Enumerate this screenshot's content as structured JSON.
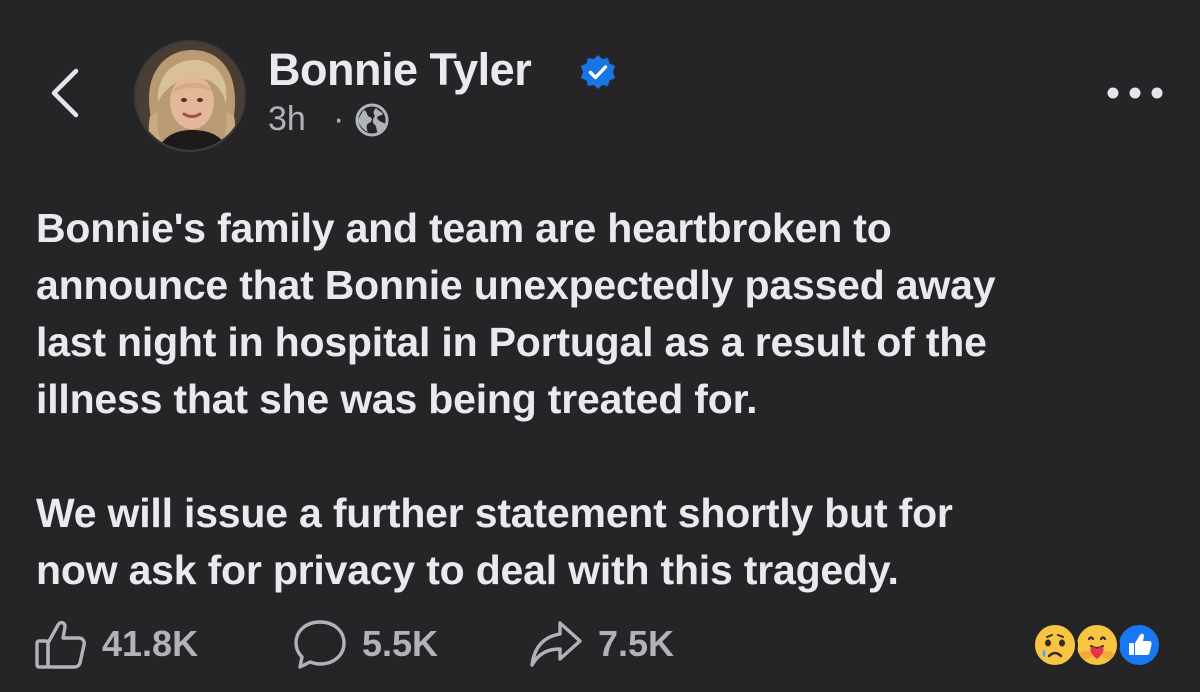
{
  "header": {
    "author_name": "Bonnie Tyler",
    "timestamp": "3h",
    "separator": "·",
    "back_icon": "chevron-left-icon",
    "verified_icon": "verified-badge-icon",
    "privacy_icon": "globe-icon",
    "more_icon": "more-horizontal-icon"
  },
  "post": {
    "lines_p1": [
      "Bonnie's family and team are heartbroken to",
      "announce that Bonnie unexpectedly passed away",
      "last night in hospital in Portugal as a result of the",
      "illness that she was being treated for."
    ],
    "lines_p2": [
      "We will issue a further statement shortly but for",
      "now ask for privacy to deal with this tragedy."
    ]
  },
  "actions": {
    "like_count": "41.8K",
    "comment_count": "5.5K",
    "share_count": "7.5K"
  },
  "reactions": [
    "sad",
    "care",
    "like"
  ],
  "colors": {
    "background": "#252527",
    "text": "#e9eaee",
    "muted": "#b0b3b8",
    "verified": "#1b74e4",
    "like_blue": "#1877f2",
    "reaction_yellow": "#f7c544"
  }
}
